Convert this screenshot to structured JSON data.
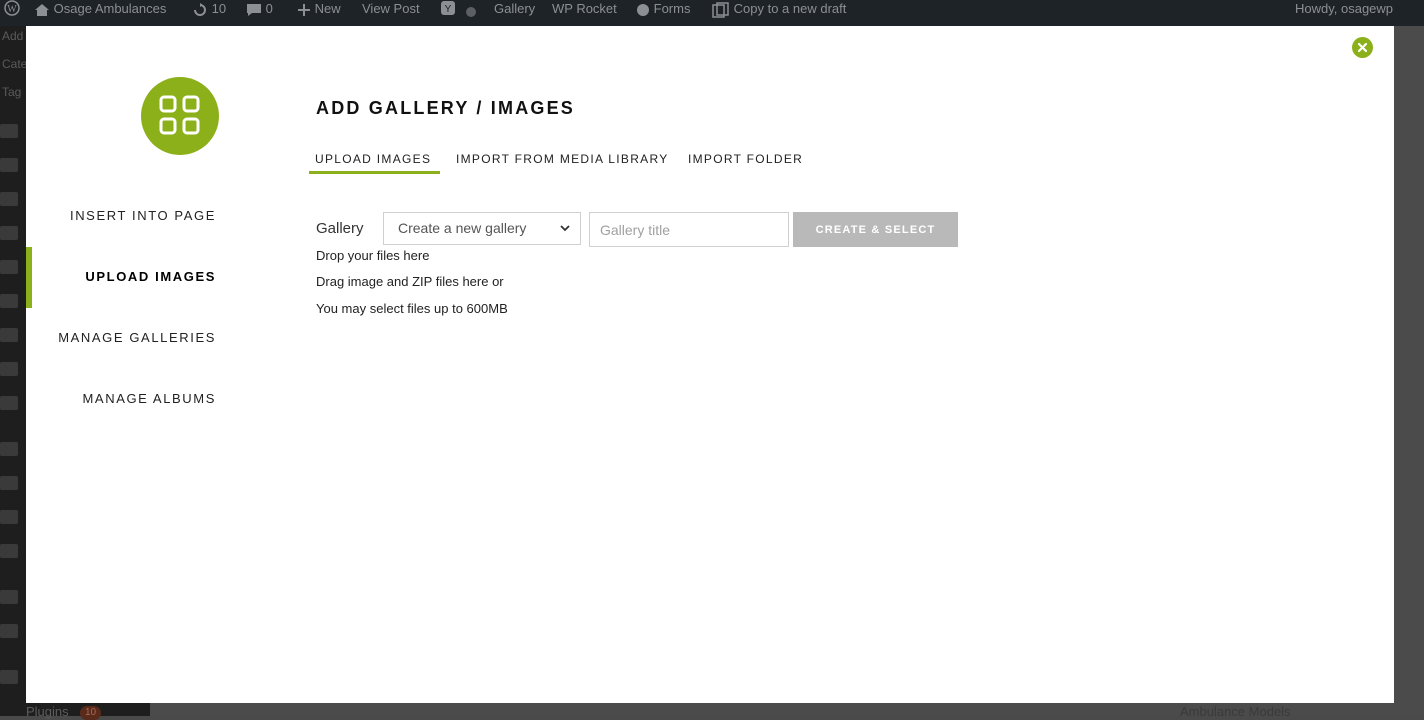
{
  "adminbar": {
    "site_name": "Osage Ambulances",
    "updates_count": "10",
    "comments_count": "0",
    "new_label": "New",
    "view_post_label": "View Post",
    "gallery_label": "Gallery",
    "wp_rocket_label": "WP Rocket",
    "forms_label": "Forms",
    "copy_draft_label": "Copy to a new draft",
    "howdy_label": "Howdy, osagewp"
  },
  "wp_sidebar": {
    "text_1": "Add",
    "text_2": "Cate",
    "text_3": "Tag",
    "plugins_label": "Plugins",
    "plugins_badge": "10"
  },
  "page_under": {
    "ambulance_models": "Ambulance Models"
  },
  "modal": {
    "nav": {
      "items": [
        {
          "label": "INSERT INTO PAGE",
          "active": false
        },
        {
          "label": "UPLOAD IMAGES",
          "active": true
        },
        {
          "label": "MANAGE GALLERIES",
          "active": false
        },
        {
          "label": "MANAGE ALBUMS",
          "active": false
        }
      ]
    },
    "title": "ADD GALLERY / IMAGES",
    "tabs": [
      {
        "label": "UPLOAD IMAGES",
        "active": true
      },
      {
        "label": "IMPORT FROM MEDIA LIBRARY",
        "active": false
      },
      {
        "label": "IMPORT FOLDER",
        "active": false
      }
    ],
    "form": {
      "gallery_label": "Gallery",
      "gallery_select_value": "Create a new gallery",
      "gallery_title_placeholder": "Gallery title",
      "create_button": "CREATE & SELECT"
    },
    "drop": {
      "line1": "Drop your files here",
      "line2": "Drag image and ZIP files here or",
      "line3": "You may select files up to 600MB"
    }
  },
  "colors": {
    "accent": "#8bb01a",
    "button_disabled": "#b9b9b9",
    "admin_bar": "#1d2327"
  },
  "icons": {
    "close": "close-icon",
    "logo": "gallery-grid-icon",
    "select_arrow": "chevron-down-icon"
  }
}
